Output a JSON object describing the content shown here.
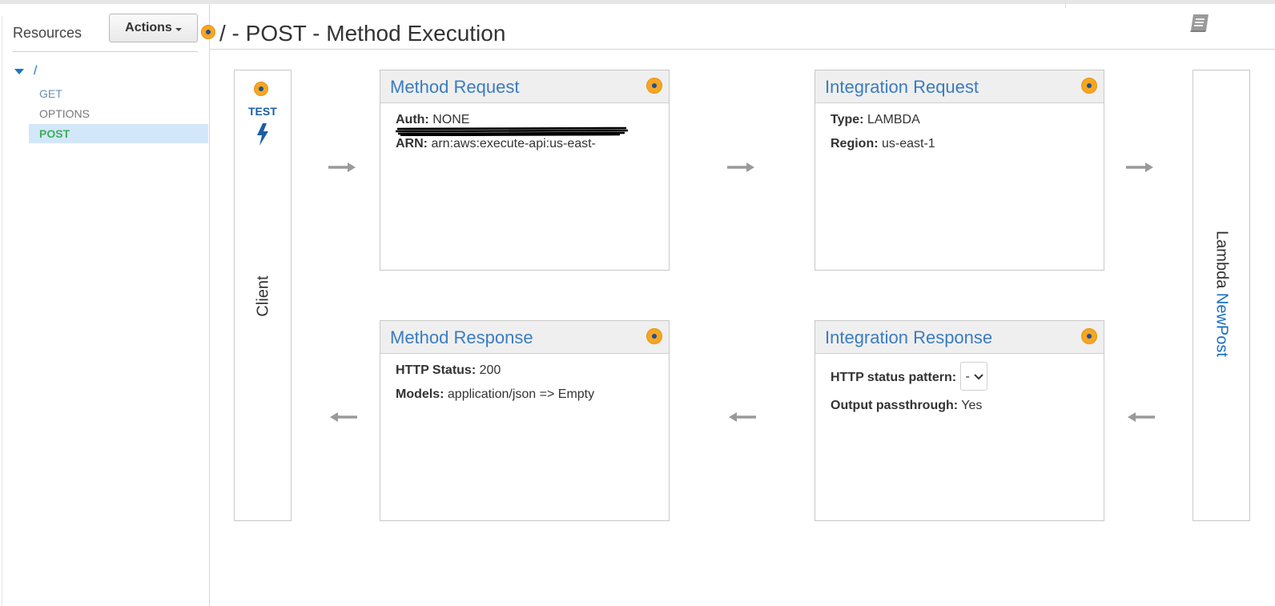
{
  "sidebar": {
    "title": "Resources",
    "actions_label": "Actions",
    "root_label": "/",
    "items": [
      {
        "label": "GET"
      },
      {
        "label": "OPTIONS"
      },
      {
        "label": "POST"
      }
    ]
  },
  "header": {
    "title": "/ - POST - Method Execution"
  },
  "client": {
    "test_label": "TEST",
    "label": "Client"
  },
  "method_request": {
    "title": "Method Request",
    "auth_label": "Auth:",
    "auth_value": "NONE",
    "arn_label": "ARN:",
    "arn_value": "arn:aws:execute-api:us-east-"
  },
  "integration_request": {
    "title": "Integration Request",
    "type_label": "Type:",
    "type_value": "LAMBDA",
    "region_label": "Region:",
    "region_value": "us-east-1"
  },
  "method_response": {
    "title": "Method Response",
    "status_label": "HTTP Status:",
    "status_value": "200",
    "models_label": "Models:",
    "models_value": "application/json => Empty"
  },
  "integration_response": {
    "title": "Integration Response",
    "pattern_label": "HTTP status pattern:",
    "pattern_value": "-",
    "passthrough_label": "Output passthrough:",
    "passthrough_value": "Yes"
  },
  "lambda": {
    "prefix": "Lambda",
    "function_name": "NewPost"
  },
  "colors": {
    "link_blue": "#3a7cc1",
    "orange_indicator": "#f5a623",
    "selected_green": "#3fae5a",
    "selected_bg": "#d3e7fa",
    "arrow_gray": "#9a9a9a"
  },
  "icons": [
    "orange-indicator-icon",
    "book-icon",
    "lightning-bolt-icon",
    "arrow-right-icon",
    "arrow-left-icon",
    "chevron-down-icon",
    "caret-down-icon",
    "triangle-down-icon"
  ]
}
